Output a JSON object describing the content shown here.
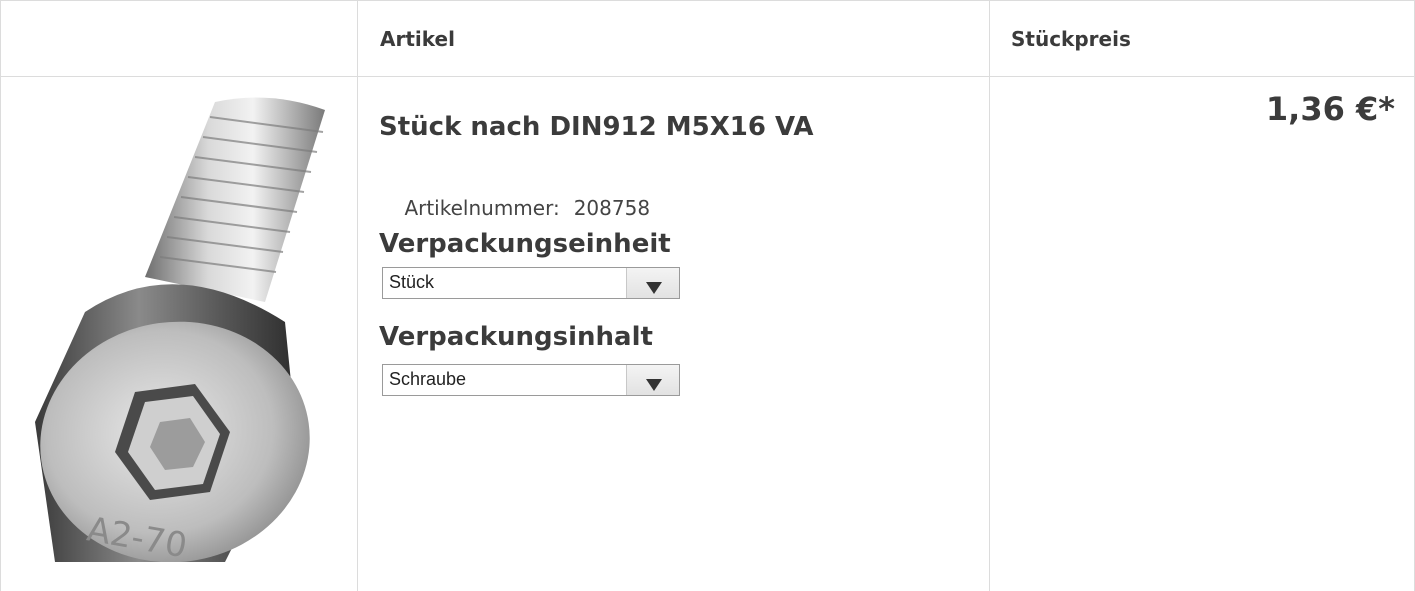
{
  "table": {
    "headers": [
      "",
      "Artikel",
      "Stückpreis"
    ]
  },
  "product": {
    "image_icon": "socket-head-cap-screw-image",
    "image_engraving": "A2-70",
    "title": "Stück nach DIN912 M5X16 VA",
    "article_number_label": "Artikelnummer:",
    "article_number": "208758",
    "options": [
      {
        "label": "Verpackungseinheit",
        "selected": "Stück"
      },
      {
        "label": "Verpackungsinhalt",
        "selected": "Schraube"
      }
    ],
    "price": "1,36 €*"
  },
  "colors": {
    "border": "#dcdcdc",
    "text": "#3b3b3b"
  }
}
